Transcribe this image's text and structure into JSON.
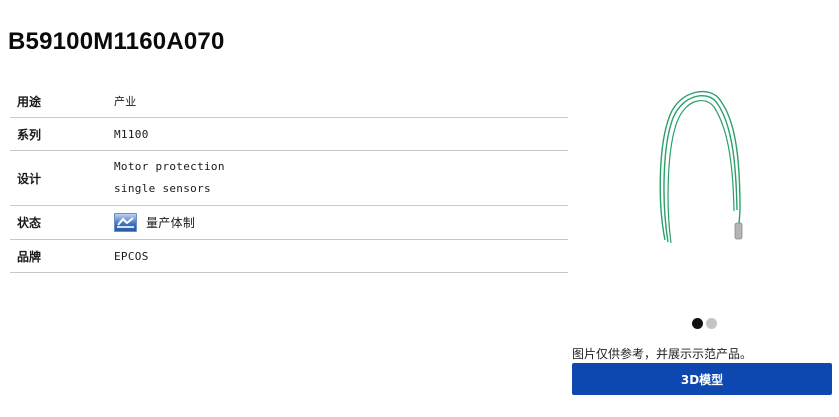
{
  "product": {
    "part_number": "B59100M1160A070"
  },
  "specs": [
    {
      "label": "用途",
      "value": "产业"
    },
    {
      "label": "系列",
      "value": "M1100"
    },
    {
      "label": "设计",
      "value_lines": [
        "Motor protection",
        "single sensors"
      ]
    },
    {
      "label": "状态",
      "value": "量产体制",
      "icon": "production-status-icon"
    },
    {
      "label": "品牌",
      "value": "EPCOS"
    }
  ],
  "gallery": {
    "image_icon": "sensor-wire-image",
    "active_index": 0,
    "count": 2,
    "caption": "图片仅供参考，并展示示范产品。"
  },
  "actions": {
    "model_3d_label": "3D模型",
    "button_color": "#0d47b0"
  }
}
